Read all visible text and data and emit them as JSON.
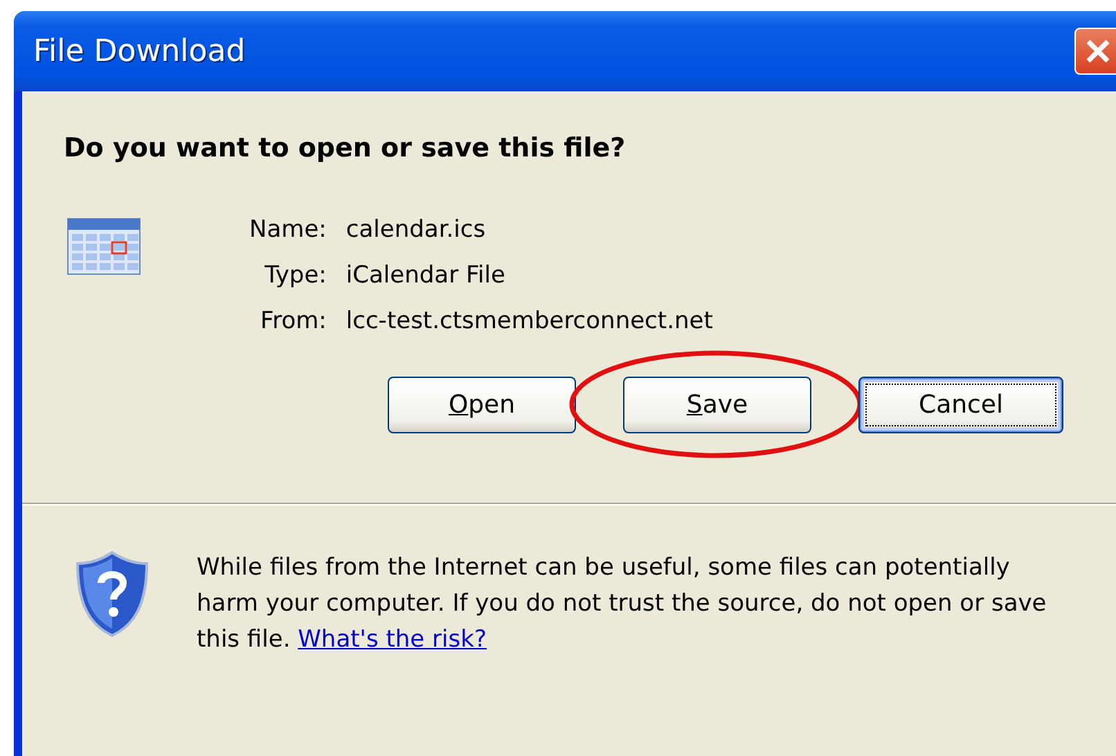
{
  "window": {
    "title": "File Download"
  },
  "heading": "Do you want to open or save this file?",
  "details": [
    {
      "label": "Name:",
      "value": "calendar.ics"
    },
    {
      "label": "Type:",
      "value": "iCalendar File"
    },
    {
      "label": "From:",
      "value": "lcc-test.ctsmemberconnect.net"
    }
  ],
  "buttons": [
    {
      "label": "Open",
      "access_key_underlined": true,
      "focused": false,
      "circled": false
    },
    {
      "label": "Save",
      "access_key_underlined": true,
      "focused": false,
      "circled": true
    },
    {
      "label": "Cancel",
      "access_key_underlined": false,
      "focused": true,
      "circled": false
    }
  ],
  "warning": {
    "text": "While files from the Internet can be useful, some files can potentially harm your computer. If you do not trust the source, do not open or save this file.",
    "link": "What's the risk?"
  }
}
